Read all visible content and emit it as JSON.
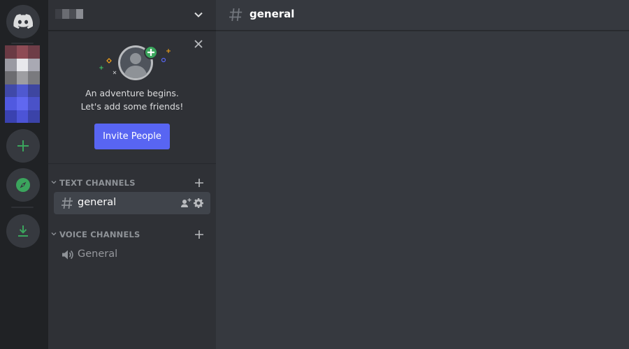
{
  "colors": {
    "accent": "#5865f2",
    "green": "#3ba55d",
    "rail_bg": "#202225",
    "sidebar_bg": "#2f3136",
    "main_bg": "#36393f"
  },
  "rail": {
    "home_icon": "discord-logo-icon",
    "add_icon": "plus-icon",
    "explore_icon": "compass-icon",
    "download_icon": "download-icon"
  },
  "sidebar": {
    "header_icon": "chevron-down-icon",
    "welcome": {
      "close_icon": "close-icon",
      "line1": "An adventure begins.",
      "line2": "Let's add some friends!",
      "invite_label": "Invite People"
    },
    "categories": [
      {
        "label": "TEXT CHANNELS",
        "channels": [
          {
            "label": "general",
            "type": "text",
            "active": true
          }
        ]
      },
      {
        "label": "VOICE CHANNELS",
        "channels": [
          {
            "label": "General",
            "type": "voice",
            "active": false
          }
        ]
      }
    ]
  },
  "main": {
    "channel_name": "general"
  }
}
